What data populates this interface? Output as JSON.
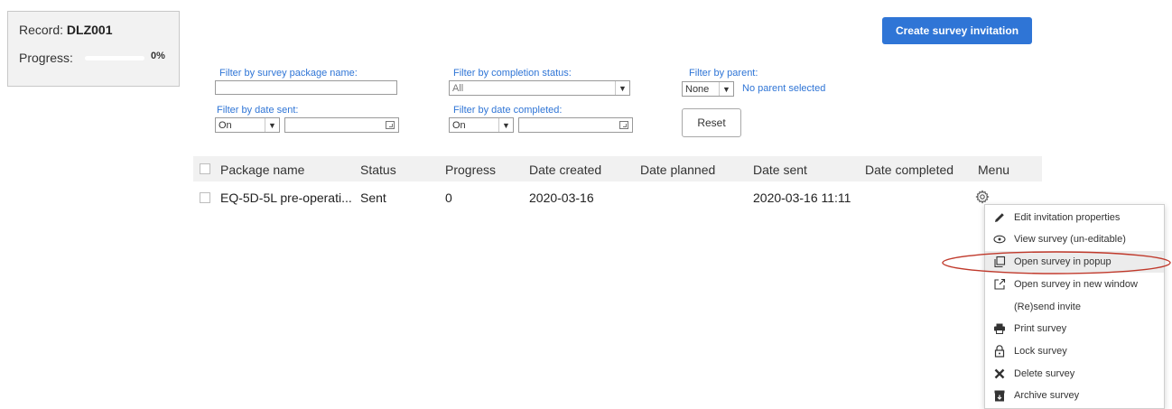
{
  "record": {
    "label": "Record:",
    "id": "DLZ001",
    "progress_label": "Progress:",
    "progress_percent": "0%",
    "progress_fraction": 0
  },
  "create_button": {
    "label": "Create survey invitation"
  },
  "filters": {
    "package_name": {
      "label": "Filter by survey package name:",
      "value": ""
    },
    "completion_status": {
      "label": "Filter by completion status:",
      "selected": "All"
    },
    "parent": {
      "label": "Filter by parent:",
      "selected": "None",
      "selection_text": "No parent selected"
    },
    "date_sent": {
      "label": "Filter by date sent:",
      "operator": "On",
      "value": ""
    },
    "date_completed": {
      "label": "Filter by date completed:",
      "operator": "On",
      "value": ""
    },
    "reset_label": "Reset"
  },
  "table": {
    "columns": [
      "Package name",
      "Status",
      "Progress",
      "Date created",
      "Date planned",
      "Date sent",
      "Date completed",
      "Menu"
    ],
    "rows": [
      {
        "package_name": "EQ-5D-5L pre-operati...",
        "status": "Sent",
        "progress": "0",
        "date_created": "2020-03-16",
        "date_planned": "",
        "date_sent": "2020-03-16 11:11",
        "date_completed": ""
      }
    ]
  },
  "menu": {
    "items": [
      {
        "label": "Edit invitation properties",
        "icon": "pencil-icon"
      },
      {
        "label": "View survey (un-editable)",
        "icon": "eye-icon"
      },
      {
        "label": "Open survey in popup",
        "icon": "popup-icon"
      },
      {
        "label": "Open survey in new window",
        "icon": "external-link-icon"
      },
      {
        "label": "(Re)send invite",
        "icon": ""
      },
      {
        "label": "Print survey",
        "icon": "printer-icon"
      },
      {
        "label": "Lock survey",
        "icon": "lock-icon"
      },
      {
        "label": "Delete survey",
        "icon": "x-icon"
      },
      {
        "label": "Archive survey",
        "icon": "archive-icon"
      }
    ]
  },
  "colors": {
    "accent": "#2f75d6",
    "highlight_ellipse": "#c0392b"
  }
}
